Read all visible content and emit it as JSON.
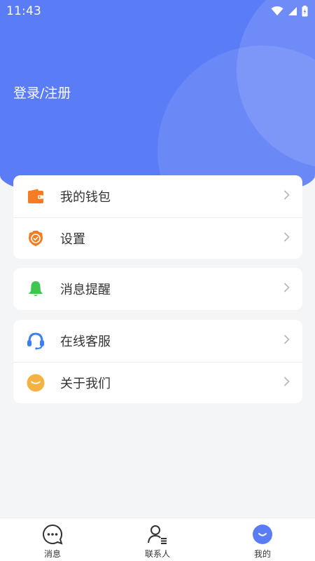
{
  "status_bar": {
    "time": "11:43"
  },
  "header": {
    "login_label": "登录/注册"
  },
  "menu": {
    "group1": [
      {
        "label": "我的钱包",
        "icon": "wallet-icon",
        "color": "#f57c22"
      },
      {
        "label": "设置",
        "icon": "settings-badge-icon",
        "color": "#f57c22"
      }
    ],
    "group2": [
      {
        "label": "消息提醒",
        "icon": "bell-icon",
        "color": "#3ec650"
      }
    ],
    "group3": [
      {
        "label": "在线客服",
        "icon": "headset-icon",
        "color": "#3d7ef5"
      },
      {
        "label": "关于我们",
        "icon": "smiley-icon",
        "color": "#f4b243"
      }
    ]
  },
  "bottom_nav": [
    {
      "label": "消息",
      "icon": "chat-icon",
      "active": false
    },
    {
      "label": "联系人",
      "icon": "contacts-icon",
      "active": false
    },
    {
      "label": "我的",
      "icon": "profile-icon",
      "active": true
    }
  ],
  "colors": {
    "primary": "#5a7cf7",
    "background": "#f4f5f7",
    "active_tab": "#5a7cf7"
  }
}
